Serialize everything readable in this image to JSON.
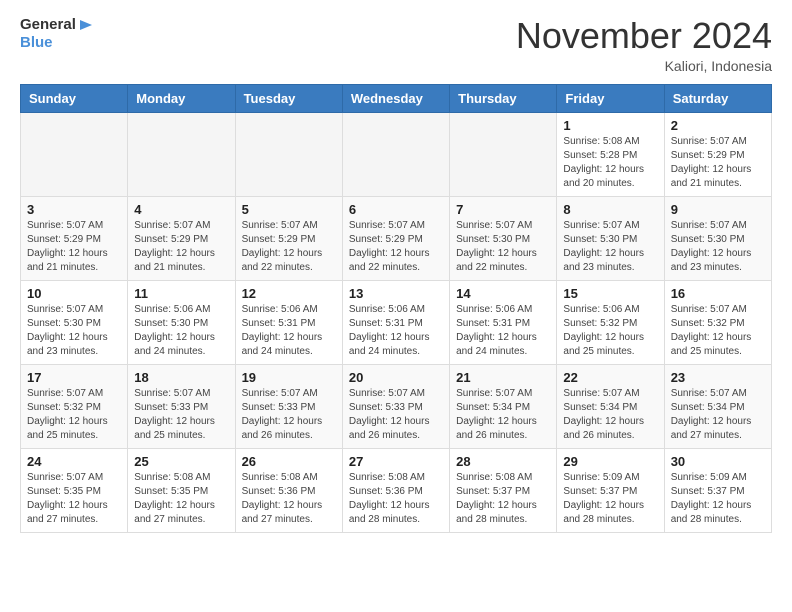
{
  "header": {
    "logo_general": "General",
    "logo_blue": "Blue",
    "month": "November 2024",
    "location": "Kaliori, Indonesia"
  },
  "weekdays": [
    "Sunday",
    "Monday",
    "Tuesday",
    "Wednesday",
    "Thursday",
    "Friday",
    "Saturday"
  ],
  "weeks": [
    [
      {
        "day": "",
        "info": ""
      },
      {
        "day": "",
        "info": ""
      },
      {
        "day": "",
        "info": ""
      },
      {
        "day": "",
        "info": ""
      },
      {
        "day": "",
        "info": ""
      },
      {
        "day": "1",
        "info": "Sunrise: 5:08 AM\nSunset: 5:28 PM\nDaylight: 12 hours\nand 20 minutes."
      },
      {
        "day": "2",
        "info": "Sunrise: 5:07 AM\nSunset: 5:29 PM\nDaylight: 12 hours\nand 21 minutes."
      }
    ],
    [
      {
        "day": "3",
        "info": "Sunrise: 5:07 AM\nSunset: 5:29 PM\nDaylight: 12 hours\nand 21 minutes."
      },
      {
        "day": "4",
        "info": "Sunrise: 5:07 AM\nSunset: 5:29 PM\nDaylight: 12 hours\nand 21 minutes."
      },
      {
        "day": "5",
        "info": "Sunrise: 5:07 AM\nSunset: 5:29 PM\nDaylight: 12 hours\nand 22 minutes."
      },
      {
        "day": "6",
        "info": "Sunrise: 5:07 AM\nSunset: 5:29 PM\nDaylight: 12 hours\nand 22 minutes."
      },
      {
        "day": "7",
        "info": "Sunrise: 5:07 AM\nSunset: 5:30 PM\nDaylight: 12 hours\nand 22 minutes."
      },
      {
        "day": "8",
        "info": "Sunrise: 5:07 AM\nSunset: 5:30 PM\nDaylight: 12 hours\nand 23 minutes."
      },
      {
        "day": "9",
        "info": "Sunrise: 5:07 AM\nSunset: 5:30 PM\nDaylight: 12 hours\nand 23 minutes."
      }
    ],
    [
      {
        "day": "10",
        "info": "Sunrise: 5:07 AM\nSunset: 5:30 PM\nDaylight: 12 hours\nand 23 minutes."
      },
      {
        "day": "11",
        "info": "Sunrise: 5:06 AM\nSunset: 5:30 PM\nDaylight: 12 hours\nand 24 minutes."
      },
      {
        "day": "12",
        "info": "Sunrise: 5:06 AM\nSunset: 5:31 PM\nDaylight: 12 hours\nand 24 minutes."
      },
      {
        "day": "13",
        "info": "Sunrise: 5:06 AM\nSunset: 5:31 PM\nDaylight: 12 hours\nand 24 minutes."
      },
      {
        "day": "14",
        "info": "Sunrise: 5:06 AM\nSunset: 5:31 PM\nDaylight: 12 hours\nand 24 minutes."
      },
      {
        "day": "15",
        "info": "Sunrise: 5:06 AM\nSunset: 5:32 PM\nDaylight: 12 hours\nand 25 minutes."
      },
      {
        "day": "16",
        "info": "Sunrise: 5:07 AM\nSunset: 5:32 PM\nDaylight: 12 hours\nand 25 minutes."
      }
    ],
    [
      {
        "day": "17",
        "info": "Sunrise: 5:07 AM\nSunset: 5:32 PM\nDaylight: 12 hours\nand 25 minutes."
      },
      {
        "day": "18",
        "info": "Sunrise: 5:07 AM\nSunset: 5:33 PM\nDaylight: 12 hours\nand 25 minutes."
      },
      {
        "day": "19",
        "info": "Sunrise: 5:07 AM\nSunset: 5:33 PM\nDaylight: 12 hours\nand 26 minutes."
      },
      {
        "day": "20",
        "info": "Sunrise: 5:07 AM\nSunset: 5:33 PM\nDaylight: 12 hours\nand 26 minutes."
      },
      {
        "day": "21",
        "info": "Sunrise: 5:07 AM\nSunset: 5:34 PM\nDaylight: 12 hours\nand 26 minutes."
      },
      {
        "day": "22",
        "info": "Sunrise: 5:07 AM\nSunset: 5:34 PM\nDaylight: 12 hours\nand 26 minutes."
      },
      {
        "day": "23",
        "info": "Sunrise: 5:07 AM\nSunset: 5:34 PM\nDaylight: 12 hours\nand 27 minutes."
      }
    ],
    [
      {
        "day": "24",
        "info": "Sunrise: 5:07 AM\nSunset: 5:35 PM\nDaylight: 12 hours\nand 27 minutes."
      },
      {
        "day": "25",
        "info": "Sunrise: 5:08 AM\nSunset: 5:35 PM\nDaylight: 12 hours\nand 27 minutes."
      },
      {
        "day": "26",
        "info": "Sunrise: 5:08 AM\nSunset: 5:36 PM\nDaylight: 12 hours\nand 27 minutes."
      },
      {
        "day": "27",
        "info": "Sunrise: 5:08 AM\nSunset: 5:36 PM\nDaylight: 12 hours\nand 28 minutes."
      },
      {
        "day": "28",
        "info": "Sunrise: 5:08 AM\nSunset: 5:37 PM\nDaylight: 12 hours\nand 28 minutes."
      },
      {
        "day": "29",
        "info": "Sunrise: 5:09 AM\nSunset: 5:37 PM\nDaylight: 12 hours\nand 28 minutes."
      },
      {
        "day": "30",
        "info": "Sunrise: 5:09 AM\nSunset: 5:37 PM\nDaylight: 12 hours\nand 28 minutes."
      }
    ]
  ]
}
